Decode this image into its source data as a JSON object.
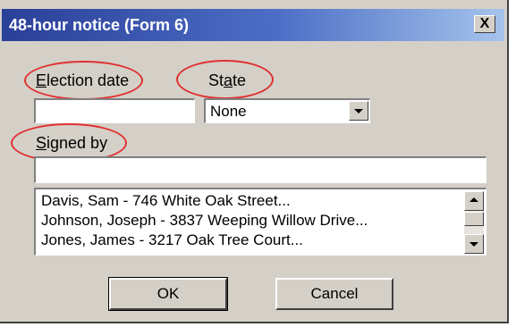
{
  "dialog": {
    "title": "48-hour notice (Form 6)",
    "close_label": "X"
  },
  "fields": {
    "election_date": {
      "label_prefix": "",
      "label_hotkey": "E",
      "label_rest": "lection date",
      "value": ""
    },
    "state": {
      "label_prefix": "St",
      "label_hotkey": "a",
      "label_rest": "te",
      "value": "None"
    },
    "signed_by": {
      "label_prefix": "",
      "label_hotkey": "S",
      "label_rest": "igned by",
      "value": ""
    }
  },
  "list": {
    "items": [
      "Davis, Sam - 746 White Oak Street...",
      "Johnson, Joseph - 3837 Weeping Willow Drive...",
      "Jones, James - 3217 Oak Tree Court..."
    ]
  },
  "buttons": {
    "ok_label": "OK",
    "cancel_label": "Cancel"
  },
  "annotations": {
    "circle_color": "#e03030"
  },
  "colors": {
    "titlebar_start": "#2a3f98",
    "titlebar_end": "#a6c4ec",
    "dialog_bg": "#d4d0c8"
  }
}
